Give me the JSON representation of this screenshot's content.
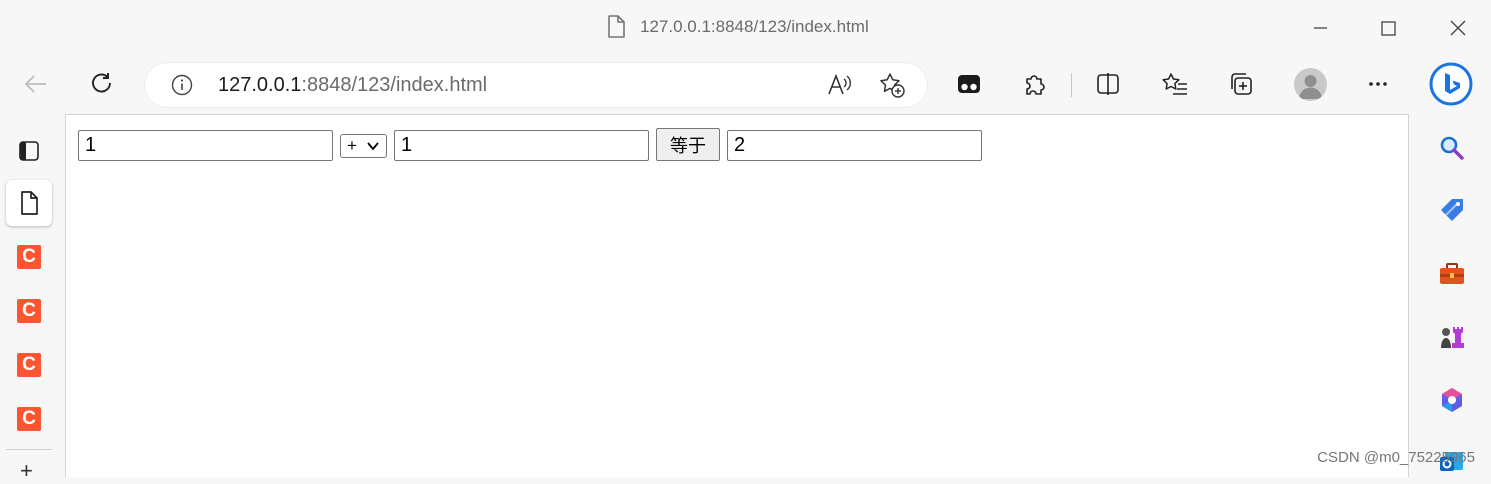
{
  "window": {
    "title": "127.0.0.1:8848/123/index.html",
    "icons": [
      "document-icon",
      "minimize-icon",
      "maximize-icon",
      "close-icon"
    ]
  },
  "toolbar": {
    "address_host": "127.0.0.1",
    "address_rest": ":8848/123/index.html",
    "icons": [
      "back-icon",
      "refresh-icon",
      "info-icon",
      "read-aloud-icon",
      "add-favorite-icon",
      "tab-actions-icon",
      "extensions-icon",
      "split-screen-icon",
      "favorites-icon",
      "collections-icon",
      "profile-avatar",
      "more-icon",
      "bing-icon"
    ]
  },
  "left_tabs": {
    "items": [
      {
        "name": "tab-panel-icon"
      },
      {
        "name": "document-tab-icon",
        "active": true
      },
      {
        "name": "csdn-tab",
        "letter": "C"
      },
      {
        "name": "csdn-tab",
        "letter": "C"
      },
      {
        "name": "csdn-tab",
        "letter": "C"
      },
      {
        "name": "csdn-tab",
        "letter": "C"
      }
    ],
    "new_tab": "+"
  },
  "page": {
    "input1_value": "1",
    "operator_value": "+",
    "input2_value": "1",
    "equals_label": "等于",
    "result_value": "2"
  },
  "right_sidebar": {
    "icons": [
      "search-icon",
      "shopping-tag-icon",
      "tools-icon",
      "games-icon",
      "office-icon",
      "outlook-icon"
    ]
  },
  "watermark": "CSDN @m0_75225965",
  "colors": {
    "csdn_favicon": "#fc5531",
    "bing_blue": "#1b74e4",
    "page_bg": "#ffffff",
    "chrome_bg": "#f7f7f7"
  }
}
